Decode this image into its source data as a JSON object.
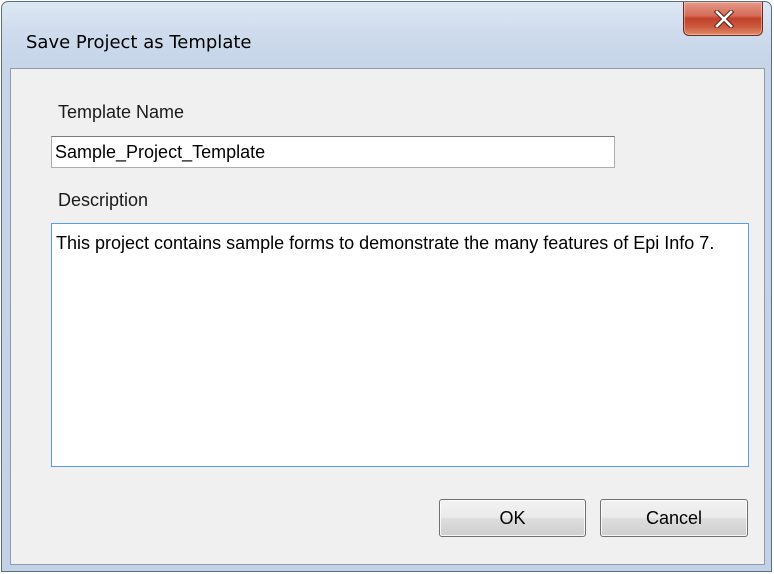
{
  "window": {
    "title": "Save Project as Template"
  },
  "form": {
    "template_name_label": "Template Name",
    "template_name_value": "Sample_Project_Template",
    "description_label": "Description",
    "description_value": "This project contains sample forms to demonstrate the many features of Epi Info 7."
  },
  "buttons": {
    "ok_label": "OK",
    "cancel_label": "Cancel"
  },
  "icons": {
    "close": "close-icon"
  },
  "colors": {
    "close_button": "#c2402a",
    "window_frame": "#c3d2e6",
    "client_area": "#f0f0f0",
    "focus_border": "#569de5"
  }
}
